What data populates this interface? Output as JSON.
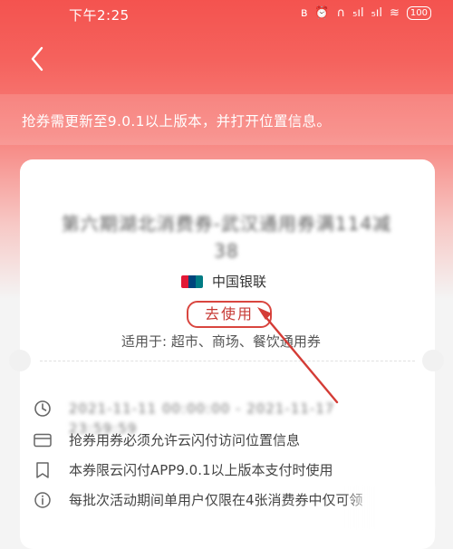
{
  "status_bar": {
    "time": "下午2:25",
    "icons": [
      {
        "name": "bluetooth-icon",
        "glyph": "ʙ"
      },
      {
        "name": "alarm-icon",
        "glyph": "⏰"
      },
      {
        "name": "nfc-icon",
        "glyph": "∩"
      },
      {
        "name": "signal-icon-1",
        "glyph": "₅ıl"
      },
      {
        "name": "signal-icon-2",
        "glyph": "₅ıl"
      },
      {
        "name": "wifi-icon",
        "glyph": "≋"
      }
    ],
    "battery": "100"
  },
  "header": {
    "back_icon": "chevron-left-icon"
  },
  "notice": {
    "text": "抢券需更新至9.0.1以上版本，并打开位置信息。"
  },
  "coupon": {
    "title_line1": "第六期湖北消费券-武汉通用券满114减",
    "title_line2": "38",
    "bank_name": "中国银联",
    "use_button_label": "去使用",
    "applicable": "适用于: 超市、商场、餐饮通用券"
  },
  "details": [
    {
      "icon": "clock-icon",
      "text": "2021-11-11 00:00:00 - 2021-11-17 23:59:59",
      "blurred": true
    },
    {
      "icon": "card-icon",
      "text": "抢券用券必须允许云闪付访问位置信息",
      "blurred": false
    },
    {
      "icon": "bookmark-icon",
      "text": "本券限云闪付APP9.0.1以上版本支付时使用",
      "blurred": false
    },
    {
      "icon": "info-icon",
      "text": "每批次活动期间单用户仅限在4张消费券中仅可领",
      "blurred": false
    }
  ],
  "colors": {
    "header_top": "#f4534f",
    "accent_red": "#d9463f",
    "annotation_arrow": "#d43c36"
  }
}
